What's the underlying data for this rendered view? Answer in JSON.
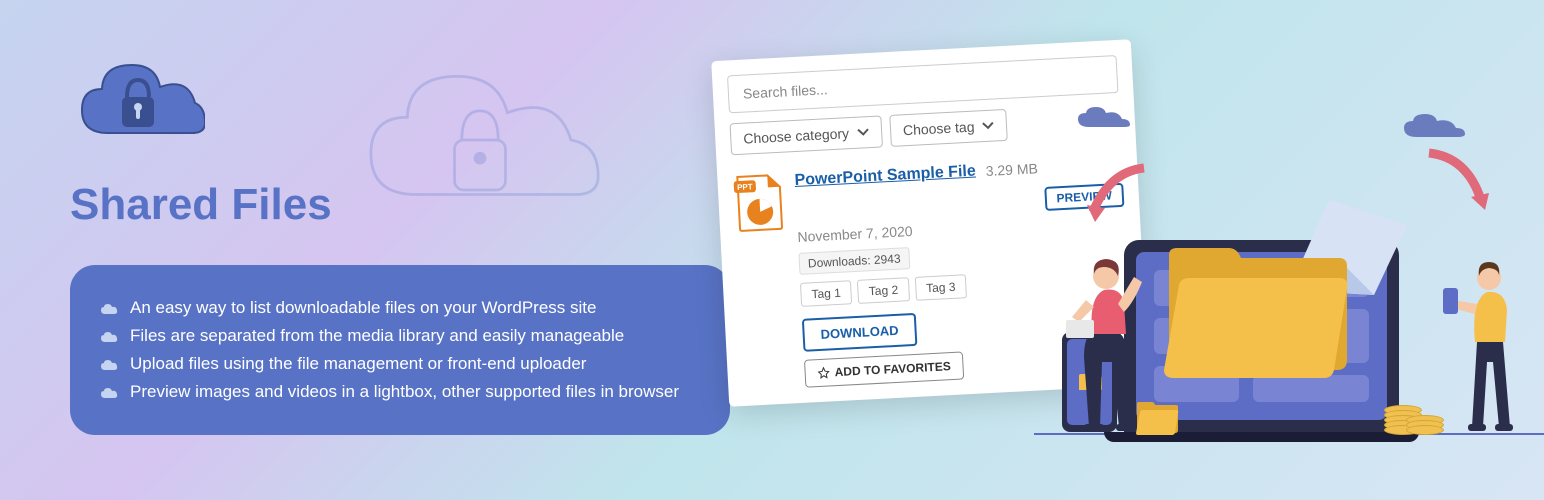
{
  "title": "Shared Files",
  "features": [
    "An easy way to list downloadable files on your WordPress site",
    "Files are separated from the media library and easily manageable",
    "Upload files using the file management or front-end uploader",
    "Preview images and videos in a lightbox, other supported files in browser"
  ],
  "screenshot": {
    "search_placeholder": "Search files...",
    "category_label": "Choose category",
    "tag_label": "Choose tag",
    "file": {
      "name": "PowerPoint Sample File",
      "size": "3.29 MB",
      "preview_btn": "PREVIEW",
      "date": "November 7, 2020",
      "downloads_label": "Downloads: 2943",
      "tags": [
        "Tag 1",
        "Tag 2",
        "Tag 3"
      ],
      "download_btn": "DOWNLOAD",
      "addfav_btn": "ADD TO FAVORITES",
      "ppt_badge": "PPT"
    }
  }
}
